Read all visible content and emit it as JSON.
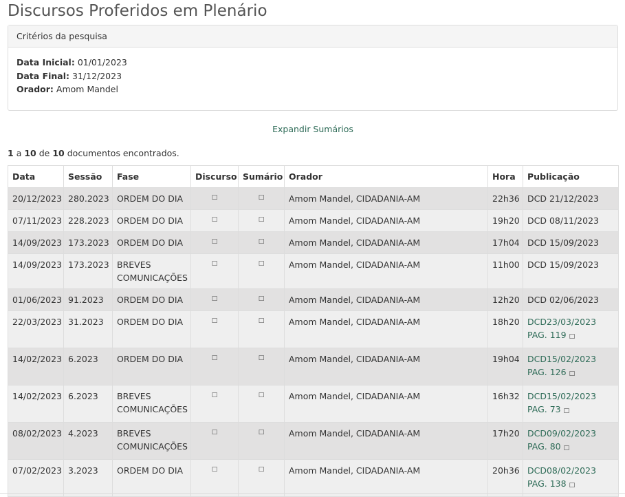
{
  "title": "Discursos Proferidos em Plenário",
  "criteria": {
    "heading": "Critérios da pesquisa",
    "start_label": "Data Inicial:",
    "start_value": "01/01/2023",
    "end_label": "Data Final:",
    "end_value": "31/12/2023",
    "speaker_label": "Orador:",
    "speaker_value": "Amom Mandel"
  },
  "expand_link": "Expandir Sumários",
  "results": {
    "from": "1",
    "a": "a",
    "to": "10",
    "de": "de",
    "total": "10",
    "suffix": "documentos encontrados."
  },
  "icons": {
    "discurso": "file-icon",
    "sumario": "file-icon",
    "external": "external-link-icon"
  },
  "table": {
    "headers": [
      "Data",
      "Sessão",
      "Fase",
      "Discurso",
      "Sumário",
      "Orador",
      "Hora",
      "Publicação"
    ],
    "rows": [
      {
        "data": "20/12/2023",
        "sessao": "280.2023",
        "fase": "ORDEM DO DIA",
        "orador": "Amom Mandel, CIDADANIA-AM",
        "hora": "22h36",
        "pub1": "DCD 21/12/2023",
        "pub2": ""
      },
      {
        "data": "07/11/2023",
        "sessao": "228.2023",
        "fase": "ORDEM DO DIA",
        "orador": "Amom Mandel, CIDADANIA-AM",
        "hora": "19h20",
        "pub1": "DCD 08/11/2023",
        "pub2": ""
      },
      {
        "data": "14/09/2023",
        "sessao": "173.2023",
        "fase": "ORDEM DO DIA",
        "orador": "Amom Mandel, CIDADANIA-AM",
        "hora": "17h04",
        "pub1": "DCD 15/09/2023",
        "pub2": ""
      },
      {
        "data": "14/09/2023",
        "sessao": "173.2023",
        "fase": "BREVES COMUNICAÇÕES",
        "orador": "Amom Mandel, CIDADANIA-AM",
        "hora": "11h00",
        "pub1": "DCD 15/09/2023",
        "pub2": ""
      },
      {
        "data": "01/06/2023",
        "sessao": "91.2023",
        "fase": "ORDEM DO DIA",
        "orador": "Amom Mandel, CIDADANIA-AM",
        "hora": "12h20",
        "pub1": "DCD 02/06/2023",
        "pub2": ""
      },
      {
        "data": "22/03/2023",
        "sessao": "31.2023",
        "fase": "ORDEM DO DIA",
        "orador": "Amom Mandel, CIDADANIA-AM",
        "hora": "18h20",
        "pub1": "DCD23/03/2023",
        "pub2": "PAG. 119"
      },
      {
        "data": "14/02/2023",
        "sessao": "6.2023",
        "fase": "ORDEM DO DIA",
        "orador": "Amom Mandel, CIDADANIA-AM",
        "hora": "19h04",
        "pub1": "DCD15/02/2023",
        "pub2": "PAG. 126"
      },
      {
        "data": "14/02/2023",
        "sessao": "6.2023",
        "fase": "BREVES COMUNICAÇÕES",
        "orador": "Amom Mandel, CIDADANIA-AM",
        "hora": "16h32",
        "pub1": "DCD15/02/2023",
        "pub2": "PAG. 73"
      },
      {
        "data": "08/02/2023",
        "sessao": "4.2023",
        "fase": "BREVES COMUNICAÇÕES",
        "orador": "Amom Mandel, CIDADANIA-AM",
        "hora": "17h20",
        "pub1": "DCD09/02/2023",
        "pub2": "PAG. 80"
      },
      {
        "data": "07/02/2023",
        "sessao": "3.2023",
        "fase": "ORDEM DO DIA",
        "orador": "Amom Mandel, CIDADANIA-AM",
        "hora": "20h36",
        "pub1": "DCD08/02/2023",
        "pub2": "PAG. 138"
      }
    ]
  }
}
